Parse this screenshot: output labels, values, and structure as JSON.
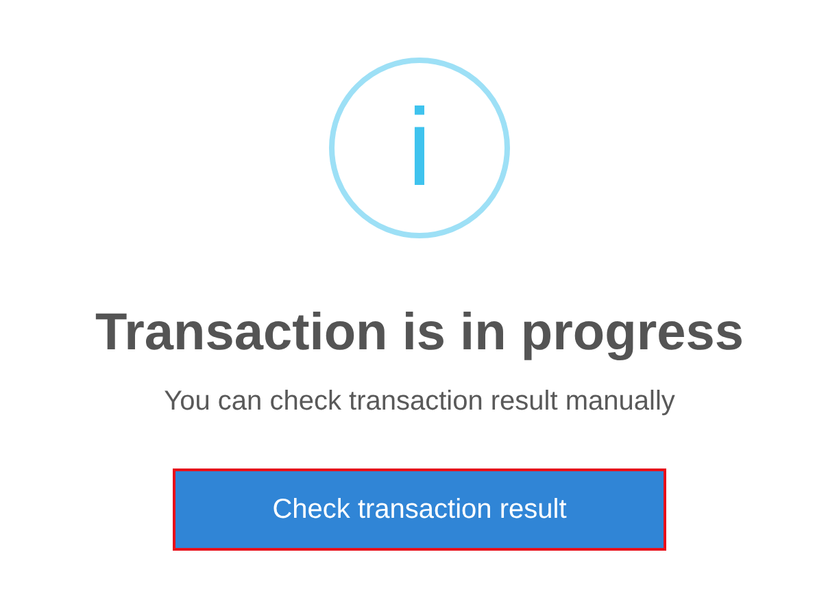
{
  "icon": {
    "glyph": "i"
  },
  "title": "Transaction is in progress",
  "message": "You can check transaction result manually",
  "button": {
    "label": "Check transaction result",
    "focused": true
  }
}
